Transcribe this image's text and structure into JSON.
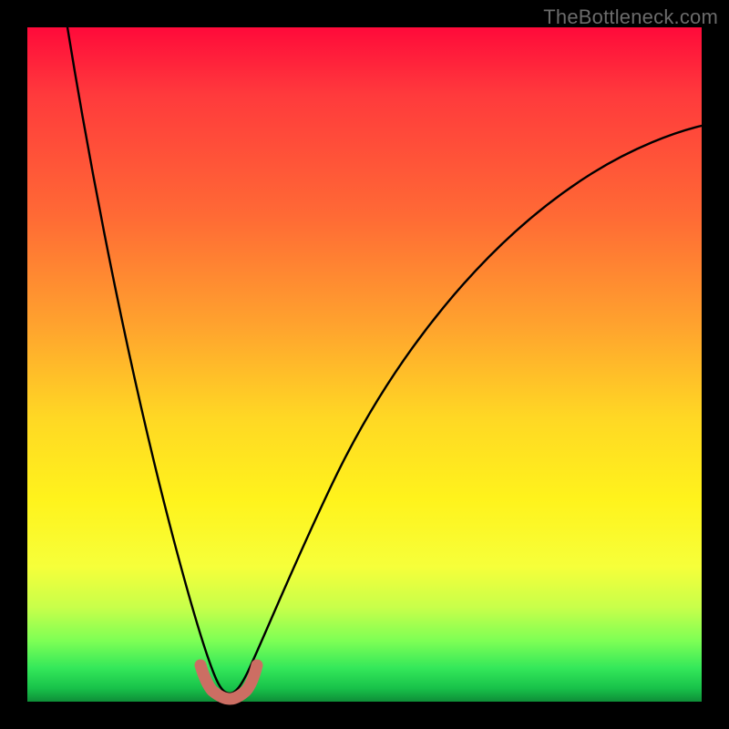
{
  "watermark": "TheBottleneck.com",
  "chart_data": {
    "type": "line",
    "title": "",
    "xlabel": "",
    "ylabel": "",
    "xlim": [
      0,
      100
    ],
    "ylim": [
      0,
      100
    ],
    "grid": false,
    "legend": false,
    "annotations": [],
    "series": [
      {
        "name": "left-branch",
        "x": [
          6,
          8,
          10,
          12,
          14,
          16,
          18,
          20,
          22,
          24,
          25,
          26,
          27
        ],
        "y": [
          100,
          90,
          79,
          68,
          57,
          46,
          35,
          25,
          16,
          8,
          5,
          3,
          2
        ],
        "stroke": "#000000"
      },
      {
        "name": "right-branch",
        "x": [
          31,
          32,
          34,
          37,
          41,
          46,
          52,
          59,
          67,
          76,
          86,
          97,
          100
        ],
        "y": [
          2,
          3,
          6,
          12,
          20,
          30,
          40,
          50,
          59,
          67,
          74,
          80,
          82
        ],
        "stroke": "#000000"
      },
      {
        "name": "valley-marker",
        "x": [
          25,
          26,
          27,
          28,
          29,
          30,
          31,
          32,
          33
        ],
        "y": [
          5.0,
          3.0,
          1.8,
          1.2,
          1.0,
          1.2,
          1.8,
          3.0,
          5.0
        ],
        "stroke": "#cc6e63",
        "style": "thick-rounded"
      }
    ],
    "gradient_stops": [
      {
        "pos": 0.0,
        "color": "#ff0a3a"
      },
      {
        "pos": 0.1,
        "color": "#ff3a3c"
      },
      {
        "pos": 0.28,
        "color": "#ff6a35"
      },
      {
        "pos": 0.44,
        "color": "#ffa22e"
      },
      {
        "pos": 0.58,
        "color": "#ffd824"
      },
      {
        "pos": 0.7,
        "color": "#fff31c"
      },
      {
        "pos": 0.8,
        "color": "#f6ff3a"
      },
      {
        "pos": 0.86,
        "color": "#c8ff4a"
      },
      {
        "pos": 0.91,
        "color": "#7dff55"
      },
      {
        "pos": 0.95,
        "color": "#34e85a"
      },
      {
        "pos": 0.98,
        "color": "#18c24a"
      },
      {
        "pos": 1.0,
        "color": "#0e8e38"
      }
    ]
  }
}
